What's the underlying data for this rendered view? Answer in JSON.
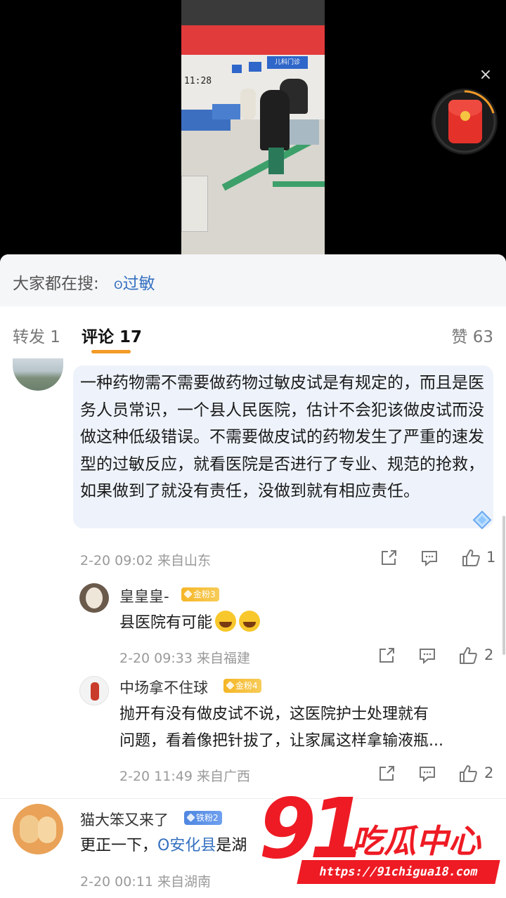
{
  "video": {
    "timestamp": "11:28",
    "sign_text": "儿科门诊"
  },
  "search_suggest": {
    "label": "大家都在搜:",
    "link_text": "过敏"
  },
  "tabs": {
    "repost": "转发 1",
    "comments": "评论 17",
    "likes": "赞 63"
  },
  "comments": [
    {
      "text": "一种药物需不需要做药物过敏皮试是有规定的，而且是医务人员常识，一个县人民医院，估计不会犯该做皮试而没做这种低级错误。不需要做皮试的药物发生了严重的速发型的过敏反应，就看医院是否进行了专业、规范的抢救，如果做到了就没有责任，没做到就有相应责任。",
      "meta": "2-20 09:02  来自山东",
      "likes": "1",
      "replies": [
        {
          "username": "皇皇皇-",
          "badge": "金粉3",
          "text": "县医院有可能",
          "meta": "2-20 09:33  来自福建",
          "likes": "2"
        },
        {
          "username": "中场拿不住球",
          "badge": "金粉4",
          "text_line1": "抛开有没有做皮试不说，这医院护士处理就有",
          "text_line2": "问题，看着像把针拔了，让家属这样拿输液瓶...",
          "meta": "2-20 11:49  来自广西",
          "likes": "2"
        }
      ]
    },
    {
      "username": "猫大笨又来了",
      "badge": "铁粉2",
      "text_prefix": "更正一下，",
      "text_link": "安化县",
      "text_suffix": "是湖",
      "meta": "2-20 00:11  来自湖南"
    }
  ],
  "watermark": {
    "number": "91",
    "brand": "吃瓜中心",
    "url": "https://91chigua18.com"
  },
  "colors": {
    "accent_orange": "#f39a27",
    "link_blue": "#3470c0",
    "watermark_red": "#ee1b24"
  }
}
